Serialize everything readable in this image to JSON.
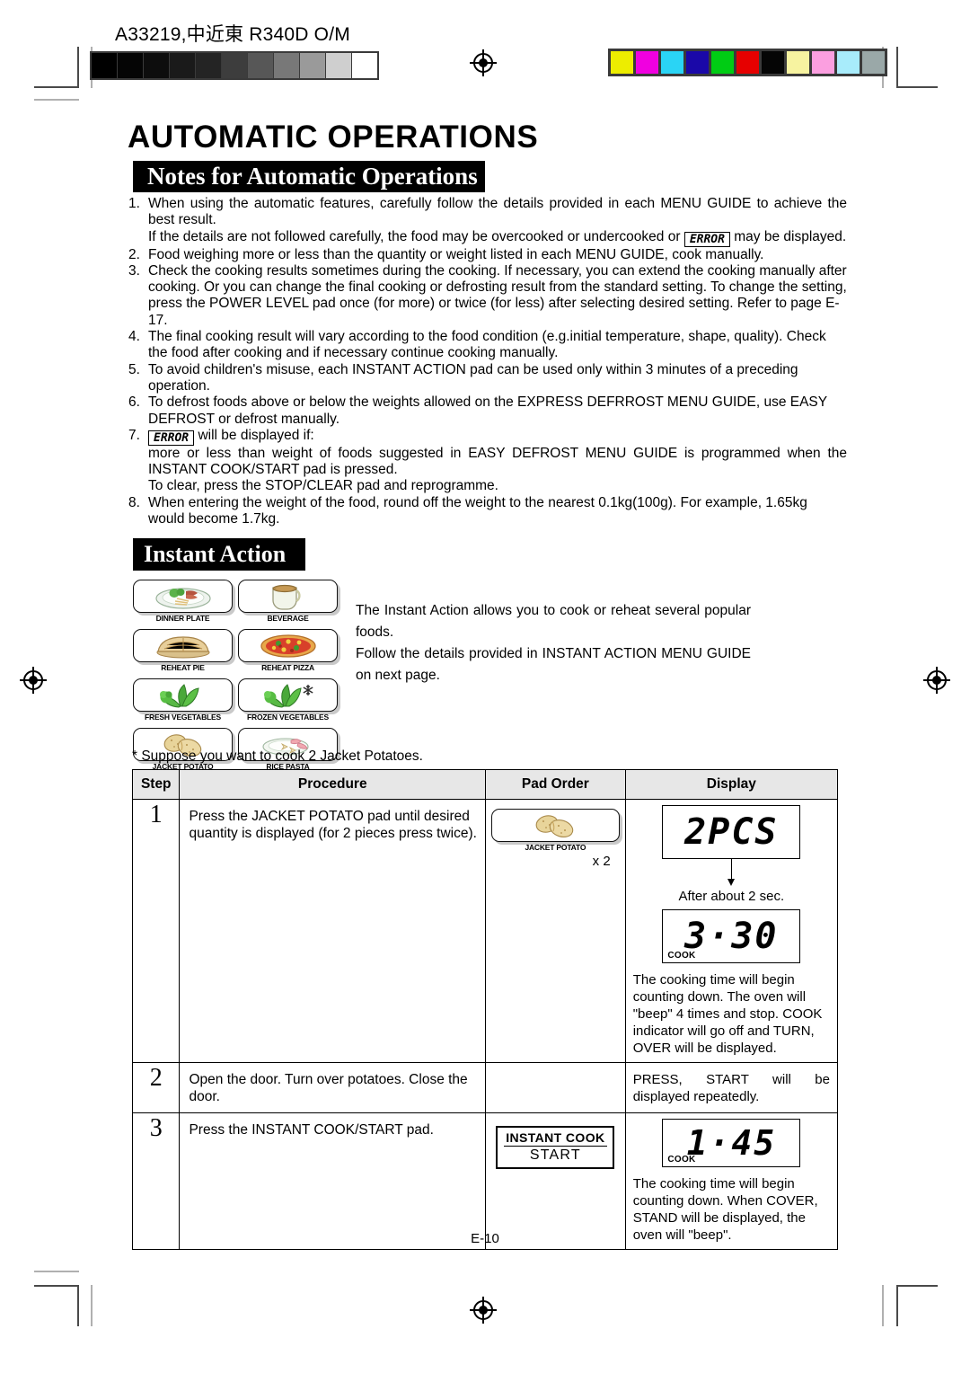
{
  "header": {
    "code": "A33219,中近東 R340D O/M"
  },
  "page": {
    "title": "AUTOMATIC OPERATIONS",
    "footer": "E-10"
  },
  "notes_section": {
    "banner": "Notes for Automatic Operations",
    "items": [
      {
        "num": "1.",
        "lines": [
          "When using the automatic features, carefully follow the details provided in each MENU GUIDE to achieve the best result.",
          "If the details are not followed carefully, the food may be overcooked or undercooked or @SEG@ may be displayed."
        ]
      },
      {
        "num": "2.",
        "lines": [
          "Food weighing more or less than the quantity or weight listed in each MENU GUIDE, cook manually."
        ]
      },
      {
        "num": "3.",
        "lines": [
          "Check the cooking results sometimes during the cooking. If necessary, you can extend the cooking manually after cooking. Or you can change the final cooking or defrosting result from the standard setting. To change the setting, press the POWER LEVEL pad once (for more) or twice (for less) after selecting desired setting. Refer to page E-17."
        ]
      },
      {
        "num": "4.",
        "lines": [
          "The final cooking result will vary according to the food condition (e.g.initial temperature, shape, quality). Check the food after cooking and if necessary continue cooking manually."
        ]
      },
      {
        "num": "5.",
        "lines": [
          "To avoid children's misuse, each INSTANT ACTION pad can be used only within 3 minutes of a preceding operation."
        ]
      },
      {
        "num": "6.",
        "lines": [
          "To defrost foods above or below the weights allowed on the EXPRESS DEFRROST MENU GUIDE, use EASY DEFROST or defrost manually."
        ]
      },
      {
        "num": "7.",
        "lines": [
          "@SEG@ will be displayed if:",
          "more or less than weight of foods suggested in EASY DEFROST MENU GUIDE is programmed when the INSTANT COOK/START pad is pressed.",
          "To clear, press the STOP/CLEAR pad and reprogramme."
        ]
      },
      {
        "num": "8.",
        "lines": [
          "When entering the weight of the food, round off the weight to the nearest 0.1kg(100g). For example, 1.65kg would become 1.7kg."
        ]
      }
    ],
    "error_word": "ERROR"
  },
  "instant_action": {
    "banner": "Instant Action",
    "pads": [
      {
        "label": "DINNER PLATE",
        "icon": "dinner-plate-icon"
      },
      {
        "label": "BEVERAGE",
        "icon": "beverage-icon"
      },
      {
        "label": "REHEAT PIE",
        "icon": "pie-icon"
      },
      {
        "label": "REHEAT PIZZA",
        "icon": "pizza-icon"
      },
      {
        "label": "FRESH VEGETABLES",
        "icon": "fresh-vegetables-icon"
      },
      {
        "label": "FROZEN VEGETABLES",
        "icon": "frozen-vegetables-icon"
      },
      {
        "label": "JACKET POTATO",
        "icon": "jacket-potato-icon"
      },
      {
        "label": "RICE PASTA",
        "icon": "rice-pasta-icon"
      }
    ],
    "blurb_1": "The Instant Action allows you to cook or reheat several popular foods.",
    "blurb_2": "Follow the details provided in INSTANT ACTION MENU GUIDE on next page."
  },
  "example": {
    "suppose": "* Suppose you want to cook 2 Jacket Potatoes.",
    "columns": [
      "Step",
      "Procedure",
      "Pad Order",
      "Display"
    ],
    "rows": [
      {
        "step": "1",
        "procedure": "Press the JACKET POTATO pad until desired quantity is displayed (for 2 pieces press twice).",
        "pad_label": "JACKET POTATO",
        "pad_count": "x 2",
        "display_1": "2PCS",
        "arrow_note": "After about 2 sec.",
        "display_2": "3·30",
        "display_2_indicator": "COOK",
        "note": "The cooking time will begin counting down. The oven will \"beep\" 4 times and stop. COOK indicator will go off and TURN, OVER will be displayed."
      },
      {
        "step": "2",
        "procedure": "Open the door. Turn over potatoes. Close the door.",
        "note": "PRESS, START will be displayed repeatedly."
      },
      {
        "step": "3",
        "procedure": "Press the INSTANT COOK/START pad.",
        "pad_line_1": "INSTANT  COOK",
        "pad_line_2": "START",
        "display_1": "1·45",
        "display_1_indicator": "COOK",
        "note": "The cooking time will begin counting down. When COVER, STAND will be displayed, the oven will \"beep\"."
      }
    ]
  },
  "prepress": {
    "gray_steps": [
      "#000000",
      "#050505",
      "#0d0d0d",
      "#1a1a1a",
      "#242424",
      "#3d3d3d",
      "#575757",
      "#787878",
      "#9a9a9a",
      "#cfcfcf",
      "#ffffff"
    ],
    "color_steps": [
      "#eded00",
      "#f000e0",
      "#2ad4f5",
      "#1a08a8",
      "#00cc14",
      "#e60000",
      "#050505",
      "#f7f3a0",
      "#fb9fe0",
      "#a8ecfb",
      "#9aa8a8"
    ]
  }
}
